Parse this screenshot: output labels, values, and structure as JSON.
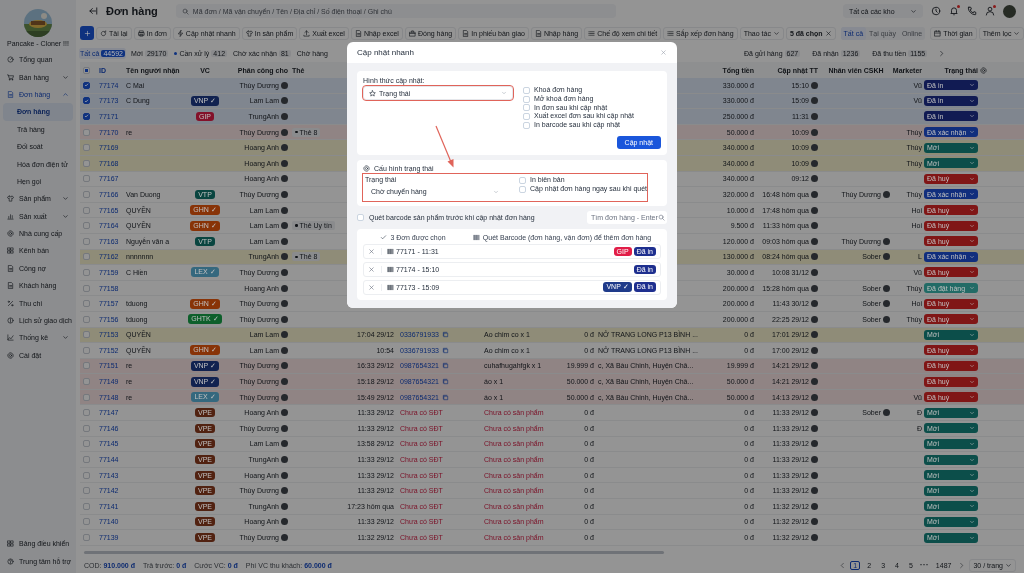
{
  "sidebar": {
    "shop_name": "Pancake - Cloner !!!",
    "items": [
      {
        "label": "Tổng quan",
        "kind": "link",
        "selected": false
      },
      {
        "label": "Bán hàng",
        "kind": "group",
        "expanded": false,
        "selected": false
      },
      {
        "label": "Đơn hàng",
        "kind": "group",
        "expanded": true,
        "selected": false,
        "children": [
          {
            "label": "Đơn hàng",
            "selected": true
          },
          {
            "label": "Trả hàng",
            "selected": false
          },
          {
            "label": "Đối soát",
            "selected": false
          },
          {
            "label": "Hóa đơn điện tử",
            "selected": false
          },
          {
            "label": "Hẹn gọi",
            "selected": false
          }
        ]
      },
      {
        "label": "Sản phẩm",
        "kind": "group",
        "expanded": false,
        "selected": false
      },
      {
        "label": "Sản xuất",
        "kind": "group",
        "expanded": false,
        "selected": false
      },
      {
        "label": "Nhà cung cấp",
        "kind": "link",
        "selected": false
      },
      {
        "label": "Kênh bán",
        "kind": "link",
        "selected": false
      },
      {
        "label": "Công nợ",
        "kind": "link",
        "selected": false
      },
      {
        "label": "Khách hàng",
        "kind": "link",
        "selected": false
      },
      {
        "label": "Thu chi",
        "kind": "link",
        "selected": false
      },
      {
        "label": "Lịch sử giao dịch",
        "kind": "link",
        "selected": false
      },
      {
        "label": "Thống kê",
        "kind": "group",
        "expanded": false,
        "selected": false
      },
      {
        "label": "Cài đặt",
        "kind": "link",
        "selected": false
      }
    ],
    "bottom_items": [
      "Bảng điều khiển",
      "Trung tâm hỗ trợ"
    ]
  },
  "header": {
    "title": "Đơn hàng",
    "search": {
      "placeholder": "Mã đơn / Mã vận chuyển / Tên / Địa chỉ / Số điện thoại / Ghi chú"
    },
    "warehouse": "Tất cả các kho"
  },
  "toolbar": {
    "buttons": [
      "Tải lại",
      "In đơn",
      "Cập nhật nhanh",
      "In sản phẩm",
      "Xuất excel",
      "Nhập excel",
      "Đóng hàng",
      "In phiếu bàn giao",
      "Nhập hàng",
      "Chế độ xem chi tiết",
      "Sắp xếp đơn hàng"
    ],
    "actions": "Thao tác",
    "selection": "5 đã chọn",
    "channel_filter": [
      {
        "label": "Tất cả",
        "selected": true
      },
      {
        "label": "Tại quầy",
        "selected": false
      },
      {
        "label": "Online",
        "selected": false
      }
    ],
    "time": "Thời gian",
    "more_filters": "Thêm lọc"
  },
  "status_tabs": {
    "left": [
      {
        "label": "Tất cả",
        "count": "44592",
        "selected": true,
        "dot": false
      },
      {
        "label": "Mới",
        "count": "29170",
        "selected": false,
        "dot": false
      },
      {
        "label": "Cần xử lý",
        "count": "412",
        "selected": false,
        "dot": true
      },
      {
        "label": "Chờ xác nhận",
        "count": "81",
        "selected": false,
        "dot": false
      },
      {
        "label": "Chờ hàng",
        "selected": false,
        "dot": false
      }
    ],
    "right": [
      {
        "label": "Đã gửi hàng",
        "count": "627",
        "selected": false,
        "dot": false
      },
      {
        "label": "Đã nhận",
        "count": "1236",
        "selected": false,
        "dot": false
      },
      {
        "label": "Đã thu tiền",
        "count": "1155",
        "selected": false,
        "dot": false
      }
    ]
  },
  "table": {
    "select_all": {
      "indeterminate": true
    },
    "columns_left": [
      "ID",
      "Tên người nhận",
      "VC",
      "Phân công cho",
      "Thẻ"
    ],
    "columns_right": [
      "Tổng tiền",
      "Cập nhật TT",
      "Nhân viên CSKH",
      "Marketer",
      "Trạng thái"
    ],
    "rows": [
      {
        "id": "77174",
        "name": "C Mai",
        "assignee": "Thùy Dương",
        "total": "330.000 đ",
        "updated": "15:10",
        "marketer": "Vũ",
        "status": {
          "label": "Đã in",
          "color": "#111b53"
        },
        "color": "#80868f",
        "checked": true
      },
      {
        "id": "77173",
        "name": "C Dung",
        "carrier": {
          "label": "VNP ✓",
          "color": "#112250"
        },
        "assignee": "Lam Lam",
        "total": "330.000 đ",
        "updated": "15:09",
        "marketer": "Vũ",
        "status": {
          "label": "Đã in",
          "color": "#111b53"
        },
        "color": "#80868f",
        "checked": true
      },
      {
        "id": "77171",
        "carrier": {
          "label": "GIP",
          "color": "#83112a"
        },
        "assignee": "TrungAnh",
        "total": "250.000 đ",
        "updated": "11:31",
        "status": {
          "label": "Đã in",
          "color": "#111b53"
        },
        "color": "#80868f",
        "checked": true
      },
      {
        "id": "77170",
        "name": "re",
        "assignee": "Thùy Dương",
        "tag": "Thẻ 8",
        "total": "50.000 đ",
        "updated": "10:09",
        "marketer": "Thùy",
        "status": {
          "label": "Đã xác nhận",
          "color": "#112e7d"
        },
        "color": "#908484",
        "checked": false
      },
      {
        "id": "77169",
        "assignee": "Hoang Anh",
        "total": "340.000 đ",
        "updated": "10:09",
        "marketer": "Thùy",
        "status": {
          "label": "Mới",
          "color": "#0c4e4a"
        },
        "color": "#8f8c78",
        "checked": false
      },
      {
        "id": "77168",
        "assignee": "Hoang Anh",
        "total": "340.000 đ",
        "updated": "10:09",
        "marketer": "Thùy",
        "status": {
          "label": "Mới",
          "color": "#0c4e4a"
        },
        "color": "#8f8c78",
        "checked": false
      },
      {
        "id": "77167",
        "assignee": "Hoang Anh",
        "total": "340.000 đ",
        "updated": "09:12",
        "status": {
          "label": "Đã huỷ",
          "color": "#801616"
        },
        "color": "#949494",
        "checked": false
      },
      {
        "id": "77166",
        "name": "Van Duong",
        "carrier": {
          "label": "VTP",
          "color": "#094540"
        },
        "assignee": "Thùy Dương",
        "total": "320.000 đ",
        "updated": "16:48 hôm qua",
        "cskh": "Thùy Dương",
        "marketer": "Thùy",
        "status": {
          "label": "Đã xác nhận",
          "color": "#112e7d"
        },
        "color": "#949494",
        "checked": false
      },
      {
        "id": "77165",
        "name": "QUYỀN",
        "carrier": {
          "label": "GHN ✓",
          "color": "#883307"
        },
        "assignee": "Lam Lam",
        "total": "10.000 đ",
        "updated": "17:48 hôm qua",
        "marketer": "Hoi",
        "status": {
          "label": "Đã huỷ",
          "color": "#801616"
        },
        "color": "#949494",
        "checked": false
      },
      {
        "id": "77164",
        "name": "QUYỀN",
        "carrier": {
          "label": "GHN ✓",
          "color": "#883307"
        },
        "assignee": "Lam Lam",
        "tag": "Thẻ Uy tín",
        "total": "9.500 đ",
        "updated": "11:33 hôm qua",
        "marketer": "Hoi",
        "status": {
          "label": "Đã huỷ",
          "color": "#801616"
        },
        "color": "#949494",
        "checked": false
      },
      {
        "id": "77163",
        "name": "Nguyễn văn a",
        "carrier": {
          "label": "VTP",
          "color": "#094540"
        },
        "assignee": "Lam Lam",
        "total": "120.000 đ",
        "updated": "09:03 hôm qua",
        "cskh": "Thùy Dương",
        "status": {
          "label": "Đã huỷ",
          "color": "#801616"
        },
        "color": "#949494",
        "checked": false
      },
      {
        "id": "77162",
        "name": "nnnnnnn",
        "assignee": "TrungAnh",
        "tag": "Thẻ 8",
        "total": "130.000 đ",
        "updated": "08:24 hôm qua",
        "cskh": "Sober",
        "marketer": "L",
        "status": {
          "label": "Đã xác nhận",
          "color": "#112e7d"
        },
        "color": "#8f8c78",
        "checked": false
      },
      {
        "id": "77159",
        "name": "C Hiền",
        "carrier": {
          "label": "LEX ✓",
          "color": "#35687e"
        },
        "assignee": "Thùy Dương",
        "total": "30.000 đ",
        "updated": "10:08 31/12",
        "marketer": "Vũ",
        "status": {
          "label": "Đã huỷ",
          "color": "#801616"
        },
        "color": "#949494",
        "checked": false
      },
      {
        "id": "77158",
        "assignee": "Hoang Anh",
        "total": "200.000 đ",
        "updated": "15:28 hôm qua",
        "cskh": "Sober",
        "marketer": "Thùy",
        "status": {
          "label": "Đã đặt hàng",
          "color": "#226b66"
        },
        "color": "#949494",
        "checked": false
      },
      {
        "id": "77157",
        "name": "tduong",
        "carrier": {
          "label": "GHN ✓",
          "color": "#883307"
        },
        "assignee": "Thùy Dương",
        "total": "200.000 đ",
        "updated": "11:43 30/12",
        "cskh": "Sober",
        "marketer": "Hoi",
        "status": {
          "label": "Đã huỷ",
          "color": "#801616"
        },
        "color": "#949494",
        "checked": false
      },
      {
        "id": "77156",
        "name": "tduong",
        "carrier": {
          "label": "GHTK ✓",
          "color": "#0d5f2b"
        },
        "assignee": "Thùy Dương",
        "total": "200.000 đ",
        "updated": "22:25 29/12",
        "cskh": "Sober",
        "marketer": "Thùy",
        "status": {
          "label": "Đã huỷ",
          "color": "#801616"
        },
        "color": "#949494",
        "checked": false
      },
      {
        "id": "77153",
        "name": "QUYỀN",
        "assignee": "Lam Lam",
        "time": "17:04 29/12",
        "phone": {
          "text": "0336791933",
          "kind": "number"
        },
        "product": {
          "text": "Ao chim co x 1",
          "kind": "item"
        },
        "amount": "0 đ",
        "address": "NỞ TRANG LONG P13 BÌNH ...",
        "total": "0 đ",
        "updated": "17:01 29/12",
        "status": {
          "label": "Mới",
          "color": "#0c4e4a"
        },
        "color": "#8f8c78",
        "checked": false
      },
      {
        "id": "77152",
        "name": "QUYỀN",
        "carrier": {
          "label": "GHN ✓",
          "color": "#883307"
        },
        "assignee": "Lam Lam",
        "time": "10:54",
        "phone": {
          "text": "0336791933",
          "kind": "number"
        },
        "product": {
          "text": "Ao chim co x 1",
          "kind": "item"
        },
        "amount": "0 đ",
        "address": "NỞ TRANG LONG P13 BÌNH ...",
        "total": "0 đ",
        "updated": "17:00 29/12",
        "status": {
          "label": "Đã huỷ",
          "color": "#801616"
        },
        "color": "#949494",
        "checked": false
      },
      {
        "id": "77151",
        "name": "re",
        "carrier": {
          "label": "VNP ✓",
          "color": "#112250"
        },
        "assignee": "Thùy Dương",
        "time": "16:33 29/12",
        "phone": {
          "text": "0987654321",
          "kind": "number"
        },
        "product": {
          "text": "cuhafhugahfgk x 1",
          "kind": "item"
        },
        "amount": "19.999 đ",
        "address": "c, Xã Bàu Chinh, Huyện Châ...",
        "total": "19.999 đ",
        "updated": "14:21 29/12",
        "status": {
          "label": "Đã huỷ",
          "color": "#801616"
        },
        "color": "#908484",
        "checked": false
      },
      {
        "id": "77149",
        "name": "re",
        "carrier": {
          "label": "VNP ✓",
          "color": "#112250"
        },
        "assignee": "Thùy Dương",
        "time": "15:18 29/12",
        "phone": {
          "text": "0987654321",
          "kind": "number"
        },
        "product": {
          "text": "áo x 1",
          "kind": "item"
        },
        "amount": "50.000 đ",
        "address": "c, Xã Bàu Chinh, Huyện Châ...",
        "total": "50.000 đ",
        "updated": "14:21 29/12",
        "status": {
          "label": "Đã huỷ",
          "color": "#801616"
        },
        "color": "#908484",
        "checked": false
      },
      {
        "id": "77148",
        "name": "re",
        "carrier": {
          "label": "LEX ✓",
          "color": "#35687e"
        },
        "assignee": "Thùy Dương",
        "time": "15:49 29/12",
        "phone": {
          "text": "0987654321",
          "kind": "number"
        },
        "product": {
          "text": "áo x 1",
          "kind": "item"
        },
        "amount": "50.000 đ",
        "address": "c, Xã Bàu Chinh, Huyện Châ...",
        "total": "50.000 đ",
        "updated": "14:13 29/12",
        "marketer": "Vũ",
        "status": {
          "label": "Đã huỷ",
          "color": "#801616"
        },
        "color": "#908484",
        "checked": false
      },
      {
        "id": "77147",
        "carrier": {
          "label": "VPE",
          "color": "#512211"
        },
        "assignee": "Hoang Anh",
        "time": "11:33 29/12",
        "phone": {
          "text": "Chưa có SĐT",
          "kind": "missing"
        },
        "product": {
          "text": "Chưa có sản phẩm",
          "kind": "missing"
        },
        "amount": "0 đ",
        "total": "0 đ",
        "updated": "11:33 29/12",
        "cskh": "Sober",
        "marketer": "Đ",
        "status": {
          "label": "Mới",
          "color": "#0c4e4a"
        },
        "color": "#949494",
        "checked": false
      },
      {
        "id": "77146",
        "carrier": {
          "label": "VPE",
          "color": "#512211"
        },
        "assignee": "Thùy Dương",
        "time": "11:33 29/12",
        "phone": {
          "text": "Chưa có SĐT",
          "kind": "missing"
        },
        "product": {
          "text": "Chưa có sản phẩm",
          "kind": "missing"
        },
        "amount": "0 đ",
        "total": "0 đ",
        "updated": "11:33 29/12",
        "marketer": "Đ",
        "status": {
          "label": "Mới",
          "color": "#0c4e4a"
        },
        "color": "#949494",
        "checked": false
      },
      {
        "id": "77145",
        "carrier": {
          "label": "VPE",
          "color": "#512211"
        },
        "assignee": "Lam Lam",
        "time": "13:58 29/12",
        "phone": {
          "text": "Chưa có SĐT",
          "kind": "missing"
        },
        "product": {
          "text": "Chưa có sản phẩm",
          "kind": "missing"
        },
        "amount": "0 đ",
        "total": "0 đ",
        "updated": "11:33 29/12",
        "status": {
          "label": "Mới",
          "color": "#0c4e4a"
        },
        "color": "#949494",
        "checked": false
      },
      {
        "id": "77144",
        "carrier": {
          "label": "VPE",
          "color": "#512211"
        },
        "assignee": "TrungAnh",
        "time": "11:33 29/12",
        "phone": {
          "text": "Chưa có SĐT",
          "kind": "missing"
        },
        "product": {
          "text": "Chưa có sản phẩm",
          "kind": "missing"
        },
        "amount": "0 đ",
        "total": "0 đ",
        "updated": "11:33 29/12",
        "status": {
          "label": "Mới",
          "color": "#0c4e4a"
        },
        "color": "#949494",
        "checked": false
      },
      {
        "id": "77143",
        "carrier": {
          "label": "VPE",
          "color": "#512211"
        },
        "assignee": "Hoang Anh",
        "time": "11:33 29/12",
        "phone": {
          "text": "Chưa có SĐT",
          "kind": "missing"
        },
        "product": {
          "text": "Chưa có sản phẩm",
          "kind": "missing"
        },
        "amount": "0 đ",
        "total": "0 đ",
        "updated": "11:33 29/12",
        "status": {
          "label": "Mới",
          "color": "#0c4e4a"
        },
        "color": "#949494",
        "checked": false
      },
      {
        "id": "77142",
        "carrier": {
          "label": "VPE",
          "color": "#512211"
        },
        "assignee": "Thùy Dương",
        "time": "11:33 29/12",
        "phone": {
          "text": "Chưa có SĐT",
          "kind": "missing"
        },
        "product": {
          "text": "Chưa có sản phẩm",
          "kind": "missing"
        },
        "amount": "0 đ",
        "total": "0 đ",
        "updated": "11:33 29/12",
        "status": {
          "label": "Mới",
          "color": "#0c4e4a"
        },
        "color": "#949494",
        "checked": false
      },
      {
        "id": "77141",
        "carrier": {
          "label": "VPE",
          "color": "#512211"
        },
        "assignee": "TrungAnh",
        "time": "17:23 hôm qua",
        "phone": {
          "text": "Chưa có SĐT",
          "kind": "missing"
        },
        "product": {
          "text": "Chưa có sản phẩm",
          "kind": "missing"
        },
        "amount": "0 đ",
        "total": "0 đ",
        "updated": "11:32 29/12",
        "status": {
          "label": "Mới",
          "color": "#0c4e4a"
        },
        "color": "#949494",
        "checked": false
      },
      {
        "id": "77140",
        "carrier": {
          "label": "VPE",
          "color": "#512211"
        },
        "assignee": "Hoang Anh",
        "time": "11:33 29/12",
        "phone": {
          "text": "Chưa có SĐT",
          "kind": "missing"
        },
        "product": {
          "text": "Chưa có sản phẩm",
          "kind": "missing"
        },
        "amount": "0 đ",
        "total": "0 đ",
        "updated": "11:32 29/12",
        "status": {
          "label": "Mới",
          "color": "#0c4e4a"
        },
        "color": "#949494",
        "checked": false
      },
      {
        "id": "77139",
        "carrier": {
          "label": "VPE",
          "color": "#512211"
        },
        "assignee": "Thùy Dương",
        "time": "11:32 29/12",
        "phone": {
          "text": "Chưa có SĐT",
          "kind": "missing"
        },
        "product": {
          "text": "Chưa có sản phẩm",
          "kind": "missing"
        },
        "amount": "0 đ",
        "total": "0 đ",
        "updated": "11:32 29/12",
        "status": {
          "label": "Mới",
          "color": "#0c4e4a"
        },
        "color": "#949494",
        "checked": false
      }
    ]
  },
  "footer": {
    "summary": [
      {
        "label": "COD:",
        "value": "910.000 đ"
      },
      {
        "label": "Trả trước:",
        "value": "0 đ"
      },
      {
        "label": "Cước VC:",
        "value": "0 đ"
      },
      {
        "label": "Phí VC thu khách:",
        "value": "60.000 đ"
      }
    ],
    "pages": [
      {
        "label": "1",
        "selected": true
      },
      {
        "label": "2",
        "selected": false
      },
      {
        "label": "3",
        "selected": false
      },
      {
        "label": "4",
        "selected": false
      },
      {
        "label": "5",
        "selected": false
      }
    ],
    "ellipsis": "···",
    "last_page": "1487",
    "page_size": "30 / trang"
  },
  "dialog": {
    "title": "Cập nhật nhanh",
    "update_type": {
      "label": "Hình thức cập nhật:",
      "value": "Trạng thái",
      "annotated": true
    },
    "options": [
      {
        "label": "Khoá đơn hàng",
        "checked": false
      },
      {
        "label": "Mở khoá đơn hàng",
        "checked": false
      },
      {
        "label": "In đơn sau khi cập nhật",
        "checked": false
      },
      {
        "label": "Xuất excel đơn sau khi cập nhật",
        "checked": false
      },
      {
        "label": "In barcode sau khi cập nhật",
        "checked": false
      }
    ],
    "submit": "Cập nhật",
    "status_config": {
      "title": "Cấu hình trạng thái",
      "annotated": true,
      "status_label": "Trạng thái",
      "status_value": "Chờ chuyển hàng",
      "options": [
        {
          "label": "In biên bản",
          "checked": false
        },
        {
          "label": "Cập nhật đơn hàng ngay sau khi quét",
          "checked": false
        }
      ]
    },
    "scan_before_update": {
      "label": "Quét barcode sản phẩm trước khi cập nhật đơn hàng",
      "checked": false
    },
    "order_search": {
      "placeholder": "Tìm đơn hàng - Enter"
    },
    "selected_count": "3 Đơn được chọn",
    "scan_hint": "Quét Barcode (đơn hàng, vận đơn) để thêm đơn hàng",
    "orders": [
      {
        "code": "77171 - 11:31",
        "badges": [
          {
            "label": "GIP",
            "color": "#e11d48"
          },
          {
            "label": "Đã in",
            "color": "#1e2f8f"
          }
        ]
      },
      {
        "code": "77174 - 15:10",
        "badges": [
          {
            "label": "Đã in",
            "color": "#1e2f8f"
          }
        ]
      },
      {
        "code": "77173 - 15:09",
        "badges": [
          {
            "label": "VNP ✓",
            "color": "#1e3a8a"
          },
          {
            "label": "Đã in",
            "color": "#1e2f8f"
          }
        ]
      }
    ]
  }
}
